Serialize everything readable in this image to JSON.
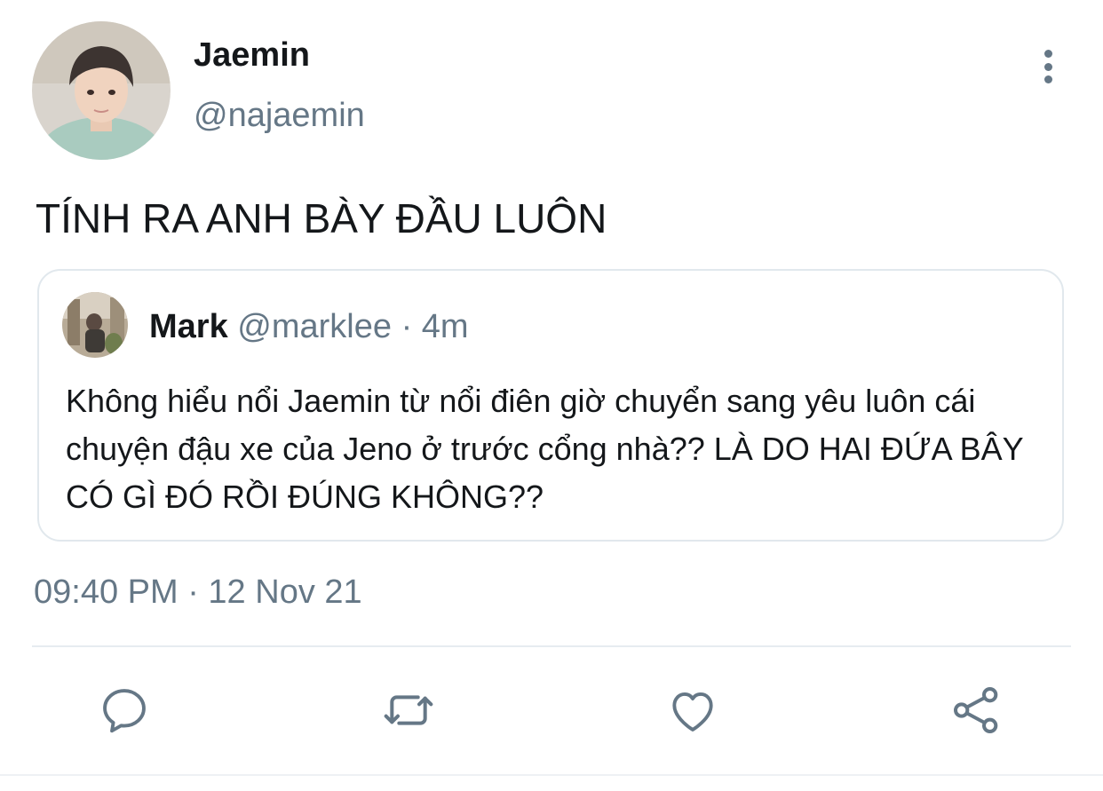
{
  "tweet": {
    "author": {
      "display_name": "Jaemin",
      "handle": "@najaemin",
      "avatar_icon": "profile-photo"
    },
    "text": "TÍNH RA ANH BÀY ĐẦU LUÔN",
    "timestamp": "09:40 PM · 12 Nov 21",
    "more_icon": "more-vertical-icon"
  },
  "quoted_tweet": {
    "author_name": "Mark",
    "author_handle": "@marklee",
    "meta_suffix": " · 4m",
    "avatar_icon": "profile-photo",
    "text": "Không hiểu nổi Jaemin từ nổi điên giờ chuyển sang yêu luôn cái chuyện đậu xe của Jeno ở trước cổng nhà?? LÀ DO HAI ĐỨA BÂY CÓ GÌ ĐÓ RỒI ĐÚNG KHÔNG??"
  },
  "actions": {
    "icons": [
      "reply-icon",
      "retweet-icon",
      "like-icon",
      "share-icon"
    ],
    "icon_color": "#657786"
  },
  "colors": {
    "text_primary": "#14171a",
    "text_secondary": "#657786",
    "border": "#e1e8ed",
    "background": "#ffffff"
  }
}
